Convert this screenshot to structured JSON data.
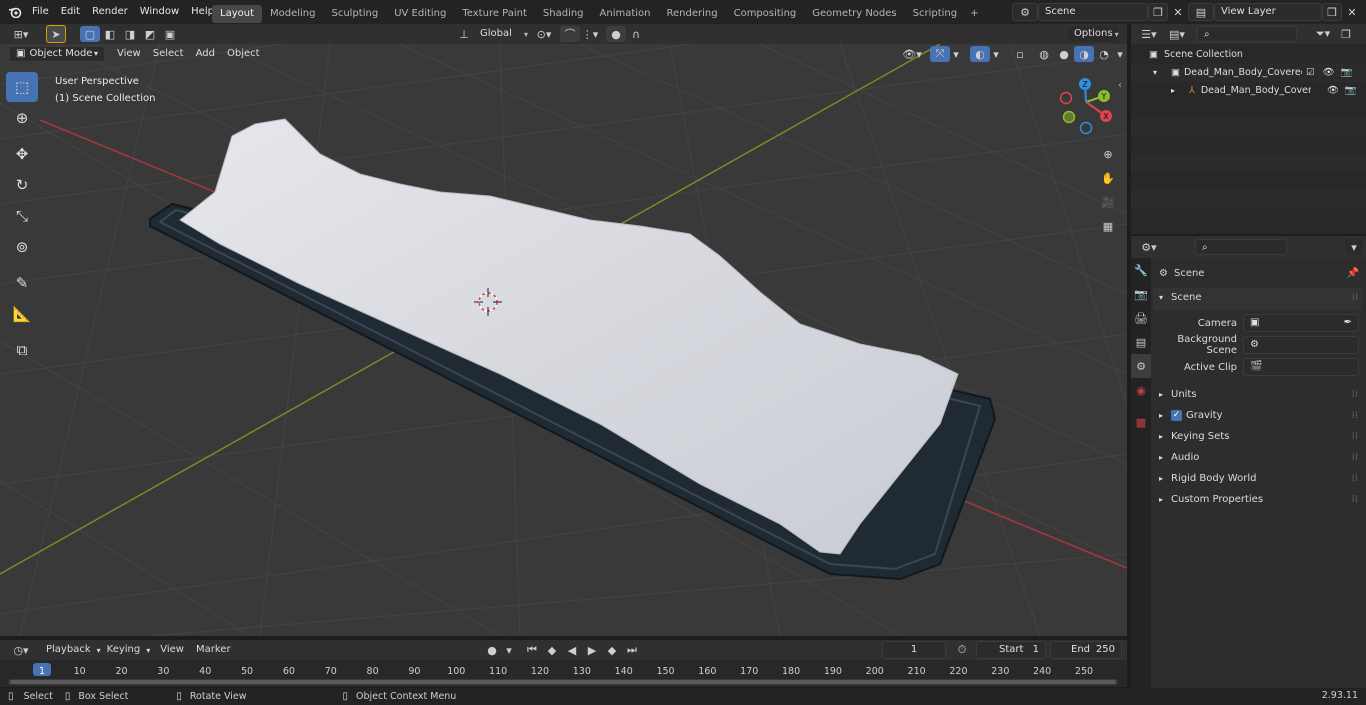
{
  "menubar": {
    "items": [
      "File",
      "Edit",
      "Render",
      "Window",
      "Help"
    ],
    "workspaces": [
      "Layout",
      "Modeling",
      "Sculpting",
      "UV Editing",
      "Texture Paint",
      "Shading",
      "Animation",
      "Rendering",
      "Compositing",
      "Geometry Nodes",
      "Scripting"
    ],
    "active_workspace": "Layout",
    "add_workspace": "+",
    "scene_name": "Scene",
    "view_layer": "View Layer"
  },
  "viewport_header": {
    "mode": "Object Mode",
    "menus": [
      "View",
      "Select",
      "Add",
      "Object"
    ],
    "transform_orientation": "Global",
    "options_label": "Options"
  },
  "viewport": {
    "perspective_label": "User Perspective",
    "collection_label": "(1) Scene Collection",
    "gizmo_axes": [
      "X",
      "Y",
      "Z"
    ]
  },
  "outliner": {
    "root": "Scene Collection",
    "items": [
      {
        "name": "Dead_Man_Body_Covered_w"
      },
      {
        "name": "Dead_Man_Body_Covere"
      }
    ]
  },
  "properties": {
    "context_title": "Scene",
    "section_title": "Scene",
    "fields": [
      {
        "label": "Camera",
        "value": ""
      },
      {
        "label": "Background Scene",
        "value": ""
      },
      {
        "label": "Active Clip",
        "value": ""
      }
    ],
    "panels": [
      {
        "label": "Units",
        "checkbox": false
      },
      {
        "label": "Gravity",
        "checkbox": true
      },
      {
        "label": "Keying Sets",
        "checkbox": false
      },
      {
        "label": "Audio",
        "checkbox": false
      },
      {
        "label": "Rigid Body World",
        "checkbox": false
      },
      {
        "label": "Custom Properties",
        "checkbox": false
      }
    ]
  },
  "timeline": {
    "menus": [
      "Playback",
      "Keying",
      "View",
      "Marker"
    ],
    "current_frame": "1",
    "start_label": "Start",
    "start_value": "1",
    "end_label": "End",
    "end_value": "250",
    "ruler": [
      "1",
      "10",
      "20",
      "30",
      "40",
      "50",
      "60",
      "70",
      "80",
      "90",
      "100",
      "110",
      "120",
      "130",
      "140",
      "150",
      "160",
      "170",
      "180",
      "190",
      "200",
      "210",
      "220",
      "230",
      "240",
      "250"
    ]
  },
  "statusbar": {
    "items": [
      "Select",
      "Box Select",
      "Rotate View",
      "Object Context Menu"
    ],
    "version": "2.93.11"
  },
  "colors": {
    "accent": "#4772b3",
    "x_axis": "#e0424f",
    "y_axis": "#8bbd2e",
    "z_axis": "#2f8fe0"
  }
}
